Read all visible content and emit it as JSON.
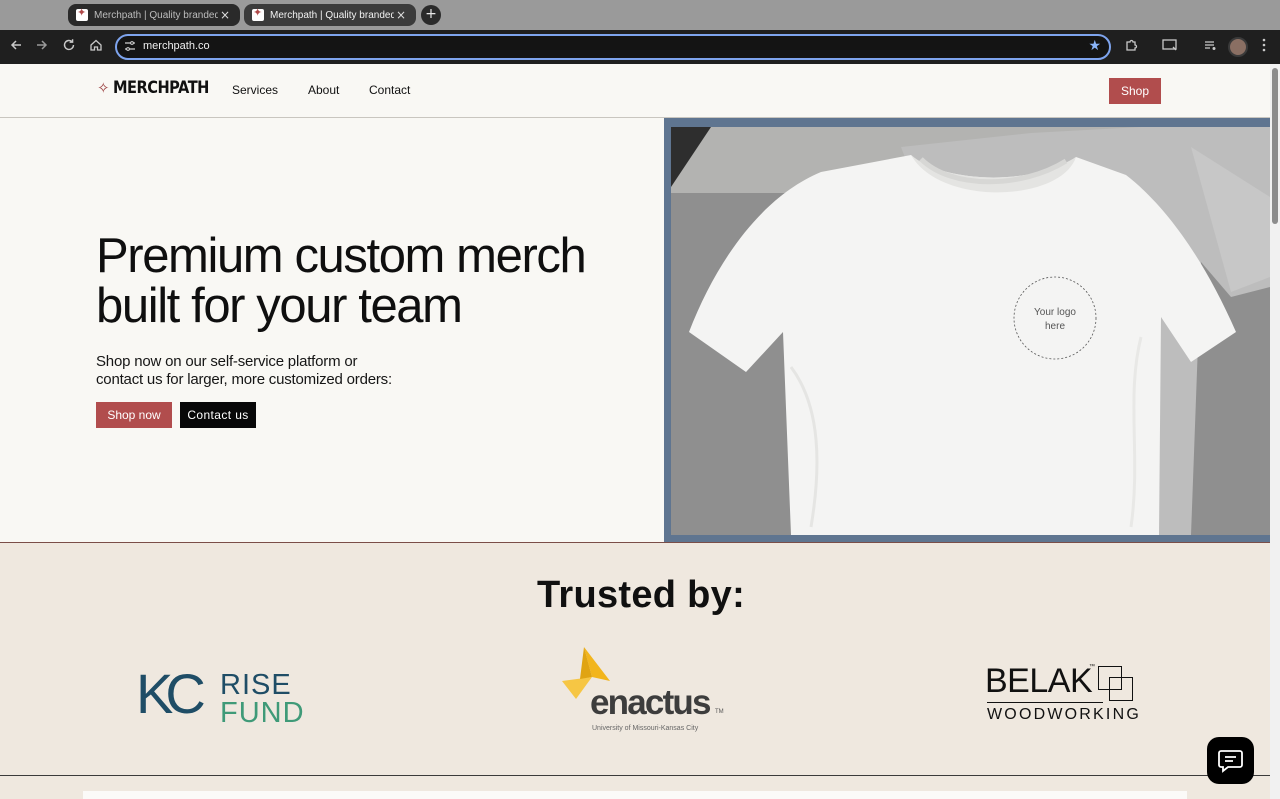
{
  "browser": {
    "tabs": [
      {
        "title": "Merchpath | Quality branded",
        "active": false
      },
      {
        "title": "Merchpath | Quality branded",
        "active": true
      }
    ],
    "new_tab_icon": "+",
    "close_icon": "×",
    "url": "merchpath.co",
    "bookmarked": true,
    "accent_color": "#8ab4f8"
  },
  "nav": {
    "logo_text": "MERCHPATH",
    "links": [
      "Services",
      "About",
      "Contact"
    ],
    "shop_label": "Shop"
  },
  "hero": {
    "headline_line1": "Premium custom merch",
    "headline_line2": "built for your team",
    "subtext_line1": "Shop now on our self-service platform or",
    "subtext_line2": "contact us for larger, more customized orders:",
    "shop_now_label": "Shop now",
    "contact_label": "Contact us",
    "logo_placeholder_line1": "Your logo",
    "logo_placeholder_line2": "here"
  },
  "trusted": {
    "title": "Trusted by:",
    "logos": {
      "kc": {
        "letters": "KC",
        "line1": "RISE",
        "line2": "FUND"
      },
      "enactus": {
        "word": "enactus",
        "tm": "TM",
        "subtitle": "University of Missouri-Kansas City"
      },
      "belak": {
        "name": "BELAK",
        "tm": "™",
        "subtitle": "WOODWORKING"
      }
    }
  },
  "colors": {
    "brand_red": "#b14d4d",
    "hero_frame": "#5f7590",
    "trusted_bg": "#efe8df",
    "kc_blue": "#1f4d66",
    "kc_green": "#3f9a78",
    "enactus_yellow": "#f2b51c"
  },
  "icons": {
    "back": "back-arrow-icon",
    "forward": "forward-arrow-icon",
    "reload": "reload-icon",
    "home": "home-icon",
    "site_info": "site-settings-icon",
    "star": "star-icon",
    "extensions": "puzzle-icon",
    "cast": "cast-icon",
    "media": "media-queue-icon",
    "menu": "kebab-menu-icon",
    "chat": "chat-icon"
  }
}
